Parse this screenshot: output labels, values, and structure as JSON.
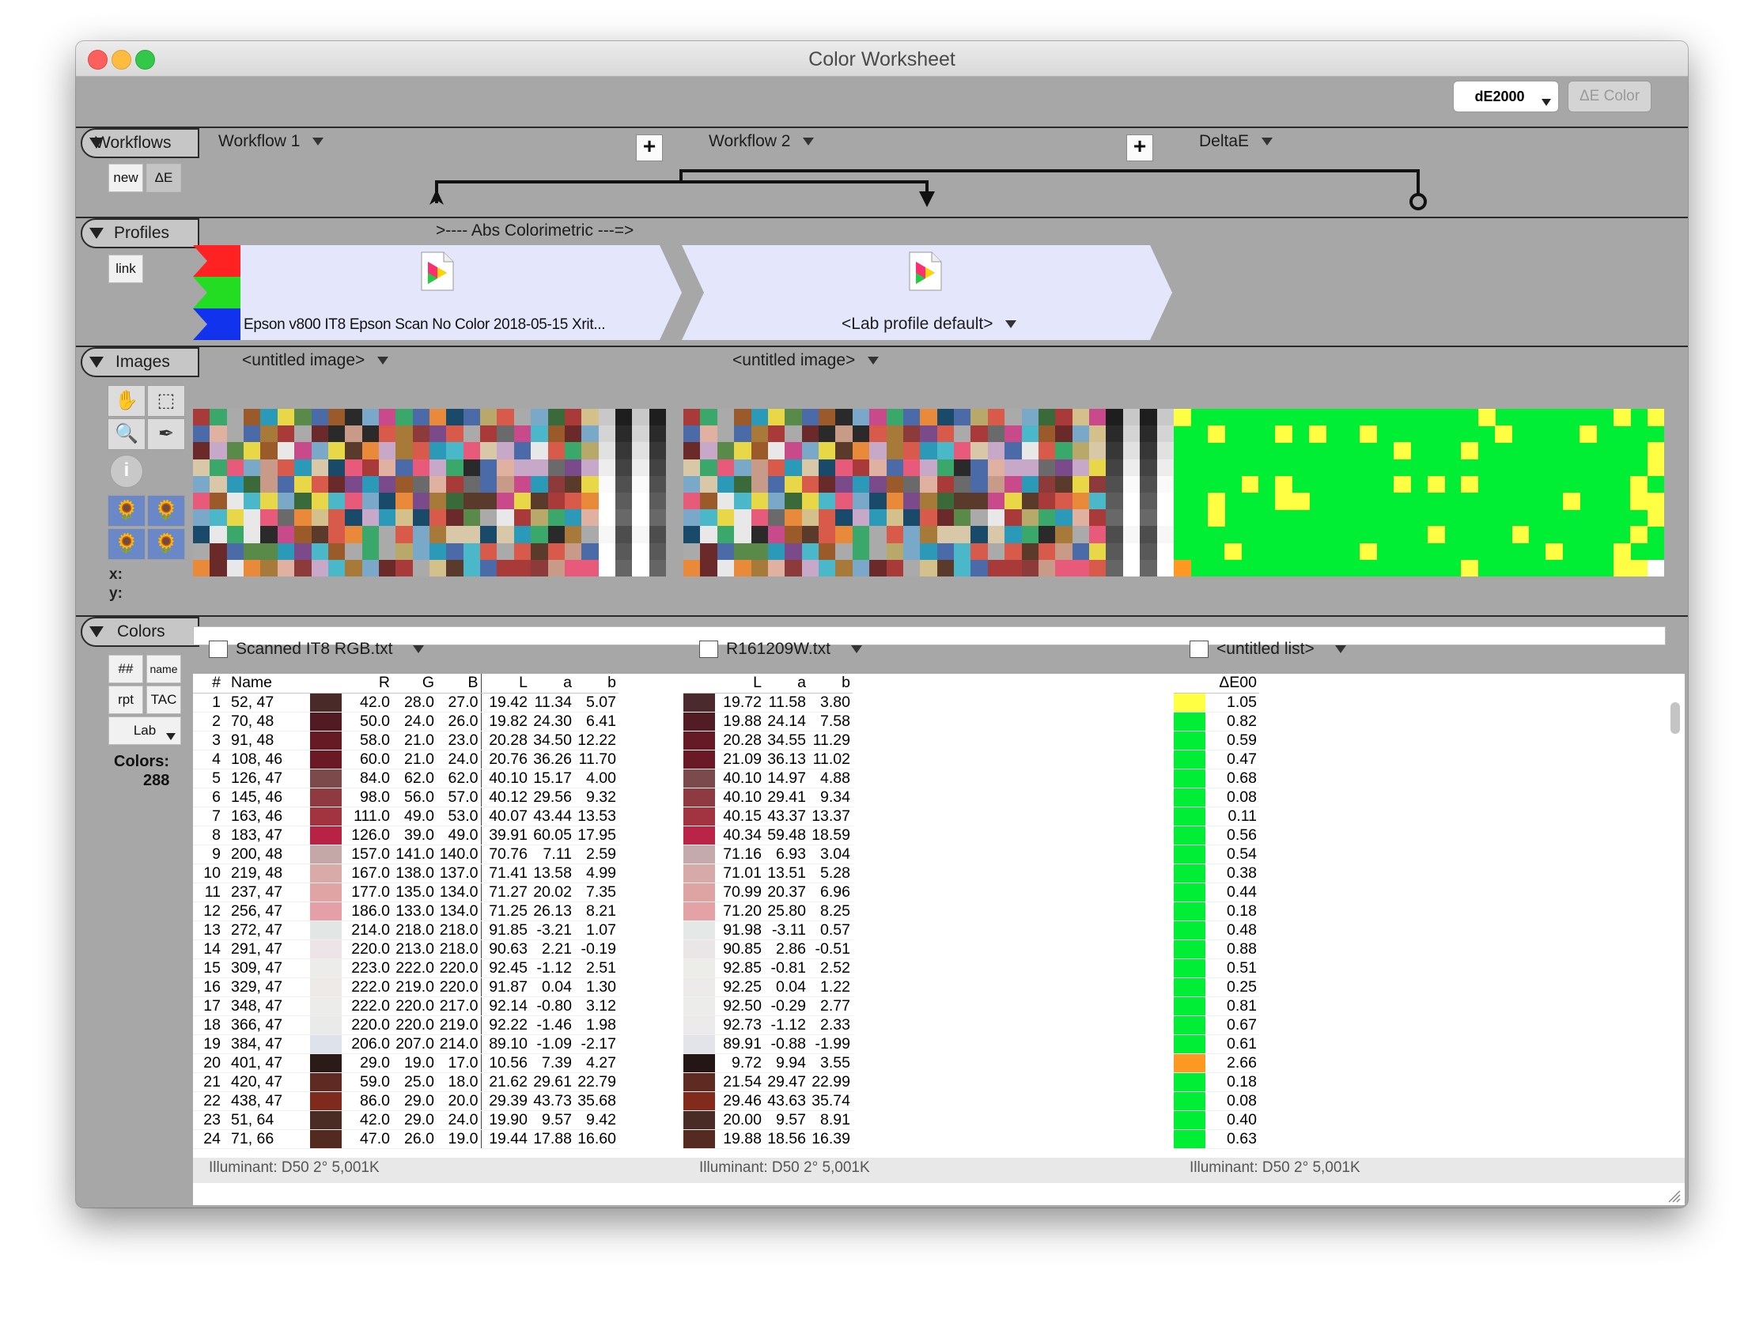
{
  "window": {
    "title": "Color Worksheet"
  },
  "toolbar": {
    "metric": "dE2000",
    "de_color_btn": "ΔE Color"
  },
  "workflows": {
    "tab": "Workflows",
    "new_btn": "new",
    "de_btn": "ΔE",
    "items": [
      "Workflow 1",
      "Workflow 2",
      "DeltaE"
    ]
  },
  "profiles": {
    "tab": "Profiles",
    "link_btn": "link",
    "intent": ">---- Abs Colorimetric ---=>",
    "profile1": "Epson v800 IT8 Epson Scan No Color 2018-05-15 Xrit...",
    "profile2": "<Lab profile default>"
  },
  "images": {
    "tab": "Images",
    "image1": "<untitled image>",
    "image2": "<untitled image>",
    "x_label": "x:",
    "y_label": "y:",
    "colors": {
      "green": "#00ee33",
      "yellow": "#ffff44",
      "orange": "#ff9922"
    }
  },
  "colors_section": {
    "tab": "Colors",
    "hash_btn": "##",
    "name_btn": "name",
    "rpt_btn": "rpt",
    "tac_btn": "TAC",
    "lab_btn": "Lab",
    "count_label": "Colors:",
    "count": "288",
    "list1": "Scanned IT8 RGB.txt",
    "list2": "R161209W.txt",
    "list3": "<untitled list>",
    "footer1": "Illuminant: D50 2° 5,001K",
    "footer2": "Illuminant: D50 2° 5,001K",
    "footer3": "Illuminant: D50 2° 5,001K"
  },
  "table1": {
    "headers": [
      "#",
      "Name",
      "",
      "R",
      "G",
      "B",
      "L",
      "a",
      "b"
    ],
    "rows": [
      [
        "1",
        "52, 47",
        "#4a2a28",
        "42.0",
        "28.0",
        "27.0",
        "19.42",
        "11.34",
        "5.07"
      ],
      [
        "2",
        "70, 48",
        "#521a22",
        "50.0",
        "24.0",
        "26.0",
        "19.82",
        "24.30",
        "6.41"
      ],
      [
        "3",
        "91, 48",
        "#661a24",
        "58.0",
        "21.0",
        "23.0",
        "20.28",
        "34.50",
        "12.22"
      ],
      [
        "4",
        "108, 46",
        "#6a1a24",
        "60.0",
        "21.0",
        "24.0",
        "20.76",
        "36.26",
        "11.70"
      ],
      [
        "5",
        "126, 47",
        "#7c4a4a",
        "84.0",
        "62.0",
        "62.0",
        "40.10",
        "15.17",
        "4.00"
      ],
      [
        "6",
        "145, 46",
        "#8e3a40",
        "98.0",
        "56.0",
        "57.0",
        "40.12",
        "29.56",
        "9.32"
      ],
      [
        "7",
        "163, 46",
        "#a23440",
        "111.0",
        "49.0",
        "53.0",
        "40.07",
        "43.44",
        "13.53"
      ],
      [
        "8",
        "183, 47",
        "#b82244",
        "126.0",
        "39.0",
        "49.0",
        "39.91",
        "60.05",
        "17.95"
      ],
      [
        "9",
        "200, 48",
        "#c4a8a8",
        "157.0",
        "141.0",
        "140.0",
        "70.76",
        "7.11",
        "2.59"
      ],
      [
        "10",
        "219, 48",
        "#d8aaa8",
        "167.0",
        "138.0",
        "137.0",
        "71.41",
        "13.58",
        "4.99"
      ],
      [
        "11",
        "237, 47",
        "#e0a4a4",
        "177.0",
        "135.0",
        "134.0",
        "71.27",
        "20.02",
        "7.35"
      ],
      [
        "12",
        "256, 47",
        "#e4a0a6",
        "186.0",
        "133.0",
        "134.0",
        "71.25",
        "26.13",
        "8.21"
      ],
      [
        "13",
        "272, 47",
        "#e2e6e4",
        "214.0",
        "218.0",
        "218.0",
        "91.85",
        "-3.21",
        "1.07"
      ],
      [
        "14",
        "291, 47",
        "#ece4e6",
        "220.0",
        "213.0",
        "218.0",
        "90.63",
        "2.21",
        "-0.19"
      ],
      [
        "15",
        "309, 47",
        "#ececea",
        "223.0",
        "222.0",
        "220.0",
        "92.45",
        "-1.12",
        "2.51"
      ],
      [
        "16",
        "329, 47",
        "#eeeae8",
        "222.0",
        "219.0",
        "220.0",
        "91.87",
        "0.04",
        "1.30"
      ],
      [
        "17",
        "348, 47",
        "#ececea",
        "222.0",
        "220.0",
        "217.0",
        "92.14",
        "-0.80",
        "3.12"
      ],
      [
        "18",
        "366, 47",
        "#eaeaea",
        "220.0",
        "220.0",
        "219.0",
        "92.22",
        "-1.46",
        "1.98"
      ],
      [
        "19",
        "384, 47",
        "#dee2ea",
        "206.0",
        "207.0",
        "214.0",
        "89.10",
        "-1.09",
        "-2.17"
      ],
      [
        "20",
        "401, 47",
        "#2a1a18",
        "29.0",
        "19.0",
        "17.0",
        "10.56",
        "7.39",
        "4.27"
      ],
      [
        "21",
        "420, 47",
        "#5e2a22",
        "59.0",
        "25.0",
        "18.0",
        "21.62",
        "29.61",
        "22.79"
      ],
      [
        "22",
        "438, 47",
        "#7e2a1c",
        "86.0",
        "29.0",
        "20.0",
        "29.39",
        "43.73",
        "35.68"
      ],
      [
        "23",
        "51, 64",
        "#4a2c24",
        "42.0",
        "29.0",
        "24.0",
        "19.90",
        "9.57",
        "9.42"
      ],
      [
        "24",
        "71, 66",
        "#522a20",
        "47.0",
        "26.0",
        "19.0",
        "19.44",
        "17.88",
        "16.60"
      ]
    ]
  },
  "table2": {
    "headers": [
      "",
      "L",
      "a",
      "b"
    ],
    "rows": [
      [
        "#4a2a2c",
        "19.72",
        "11.58",
        "3.80"
      ],
      [
        "#521c24",
        "19.88",
        "24.14",
        "7.58"
      ],
      [
        "#661a26",
        "20.28",
        "34.55",
        "11.29"
      ],
      [
        "#6a1a26",
        "21.09",
        "36.13",
        "11.02"
      ],
      [
        "#7a4a4c",
        "40.10",
        "14.97",
        "4.88"
      ],
      [
        "#8e3a42",
        "40.10",
        "29.41",
        "9.34"
      ],
      [
        "#a23442",
        "40.15",
        "43.37",
        "13.37"
      ],
      [
        "#ba2446",
        "40.34",
        "59.48",
        "18.59"
      ],
      [
        "#c4aaaa",
        "71.16",
        "6.93",
        "3.04"
      ],
      [
        "#d6aaa8",
        "71.01",
        "13.51",
        "5.28"
      ],
      [
        "#dea4a4",
        "70.99",
        "20.37",
        "6.96"
      ],
      [
        "#e2a2a6",
        "71.20",
        "25.80",
        "8.25"
      ],
      [
        "#e4e8e6",
        "91.98",
        "-3.11",
        "0.57"
      ],
      [
        "#eae6e8",
        "90.85",
        "2.86",
        "-0.51"
      ],
      [
        "#ecece8",
        "92.85",
        "-0.81",
        "2.52"
      ],
      [
        "#ecebea",
        "92.25",
        "0.04",
        "1.22"
      ],
      [
        "#ececea",
        "92.50",
        "-0.29",
        "2.77"
      ],
      [
        "#eceaea",
        "92.73",
        "-1.12",
        "2.33"
      ],
      [
        "#e2e4ea",
        "89.91",
        "-0.88",
        "-1.99"
      ],
      [
        "#241614",
        "9.72",
        "9.94",
        "3.55"
      ],
      [
        "#5e2a22",
        "21.54",
        "29.47",
        "22.99"
      ],
      [
        "#822a1c",
        "29.46",
        "43.63",
        "35.74"
      ],
      [
        "#4a2c26",
        "20.00",
        "9.57",
        "8.91"
      ],
      [
        "#542a22",
        "19.88",
        "18.56",
        "16.39"
      ]
    ]
  },
  "table3": {
    "header": "ΔE00",
    "rows": [
      [
        "#ffff44",
        "1.05"
      ],
      [
        "#00ee33",
        "0.82"
      ],
      [
        "#00ee33",
        "0.59"
      ],
      [
        "#00ee33",
        "0.47"
      ],
      [
        "#00ee33",
        "0.68"
      ],
      [
        "#00ee33",
        "0.08"
      ],
      [
        "#00ee33",
        "0.11"
      ],
      [
        "#00ee33",
        "0.56"
      ],
      [
        "#00ee33",
        "0.54"
      ],
      [
        "#00ee33",
        "0.38"
      ],
      [
        "#00ee33",
        "0.44"
      ],
      [
        "#00ee33",
        "0.18"
      ],
      [
        "#00ee33",
        "0.48"
      ],
      [
        "#00ee33",
        "0.88"
      ],
      [
        "#00ee33",
        "0.51"
      ],
      [
        "#00ee33",
        "0.25"
      ],
      [
        "#00ee33",
        "0.81"
      ],
      [
        "#00ee33",
        "0.67"
      ],
      [
        "#00ee33",
        "0.61"
      ],
      [
        "#ff9922",
        "2.66"
      ],
      [
        "#00ee33",
        "0.18"
      ],
      [
        "#00ee33",
        "0.08"
      ],
      [
        "#00ee33",
        "0.40"
      ],
      [
        "#00ee33",
        "0.63"
      ]
    ]
  }
}
